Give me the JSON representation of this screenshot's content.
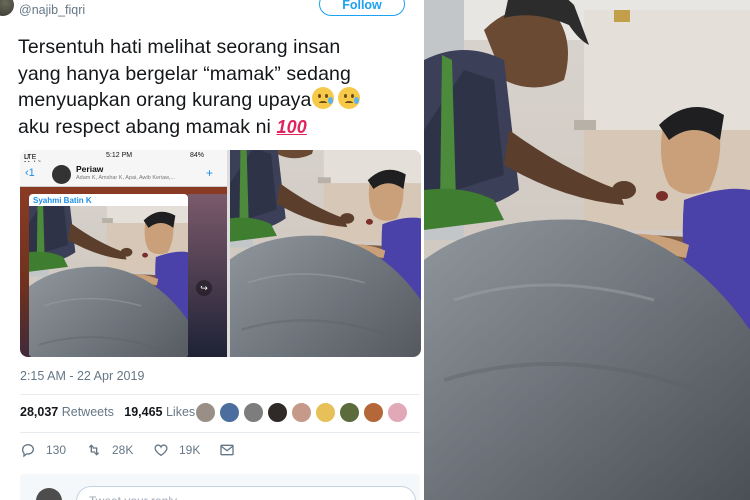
{
  "tweet": {
    "handle": "@najib_fiqri",
    "follow_label": "Follow",
    "text_lines": [
      "Tersentuh hati melihat seorang insan",
      "yang hanya bergelar “mamak” sedang",
      "menyuapkan orang kurang upaya",
      "aku respect abang mamak ni"
    ],
    "emoji": [
      "crying-face",
      "crying-face",
      "hundred-points"
    ],
    "hundred_glyph": "100",
    "timestamp": "2:15 AM - 22 Apr 2019",
    "retweets_count": "28,037",
    "retweets_label": "Retweets",
    "likes_count": "19,465",
    "likes_label": "Likes",
    "liker_colors": [
      "#9a8f86",
      "#4b6e9e",
      "#7d7d7d",
      "#2f2a28",
      "#c59a8a",
      "#e8c05a",
      "#5b6b3c",
      "#b4683a",
      "#e2a8b8"
    ],
    "actions": {
      "reply_count": "130",
      "retweet_count": "28K",
      "like_count": "19K"
    },
    "reply_placeholder": "Tweet your reply"
  },
  "screenshot": {
    "carrier": "U Mobile",
    "network": "LTE",
    "time": "5:12 PM",
    "battery": "84%",
    "back_count": "1",
    "chat_name": "Periaw",
    "chat_members": "Adam K, Amshar K, Apai, Awib Keriaw,...",
    "sender_name": "Syahmi Batin K"
  },
  "colors": {
    "accent": "#1da1f2",
    "text": "#14171a",
    "muted": "#657786"
  }
}
